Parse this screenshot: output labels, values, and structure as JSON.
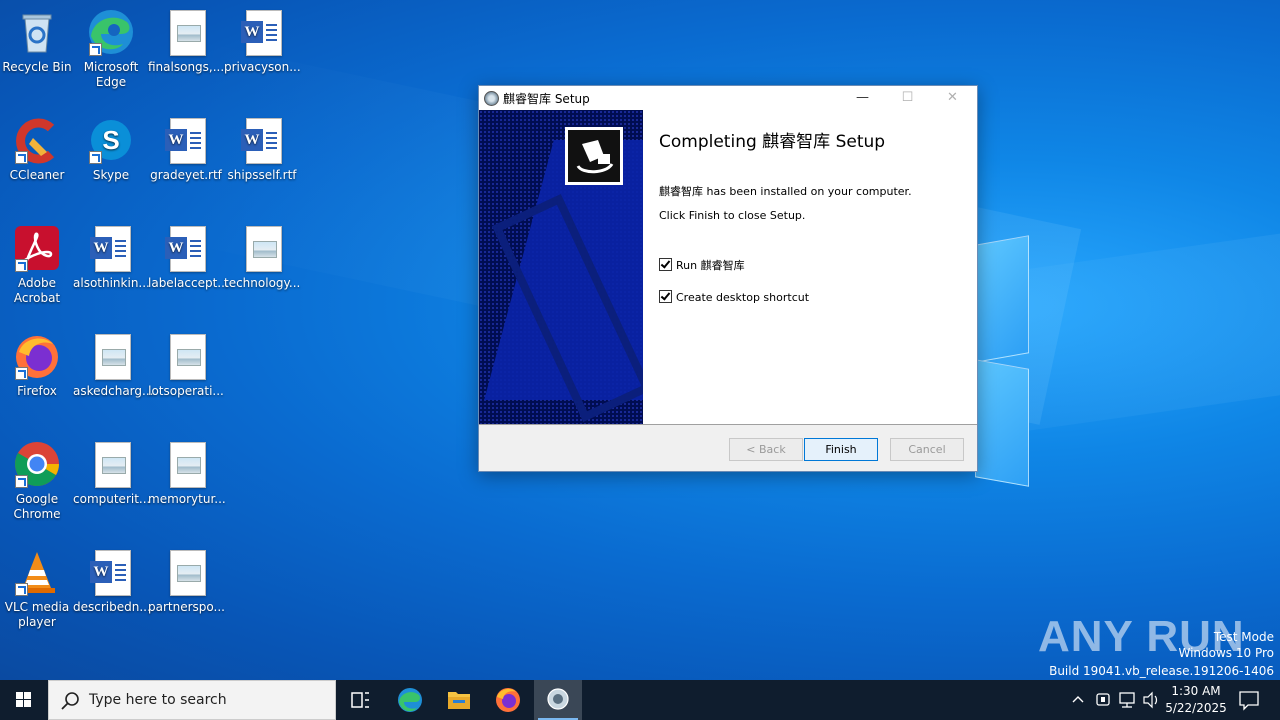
{
  "desktop": {
    "icons": [
      {
        "label": "Recycle Bin",
        "icon": "recycle-bin-icon"
      },
      {
        "label": "Microsoft Edge",
        "icon": "edge-icon"
      },
      {
        "label": "finalsongs,...",
        "icon": "image-file-icon"
      },
      {
        "label": "privacyson...",
        "icon": "word-file-icon"
      },
      {
        "label": "CCleaner",
        "icon": "ccleaner-icon"
      },
      {
        "label": "Skype",
        "icon": "skype-icon"
      },
      {
        "label": "gradeyet.rtf",
        "icon": "word-file-icon"
      },
      {
        "label": "shipsself.rtf",
        "icon": "word-file-icon"
      },
      {
        "label": "Adobe Acrobat",
        "icon": "acrobat-icon"
      },
      {
        "label": "alsothinkin...",
        "icon": "word-file-icon"
      },
      {
        "label": "labelaccept...",
        "icon": "word-file-icon"
      },
      {
        "label": "technology...",
        "icon": "image-file-icon"
      },
      {
        "label": "Firefox",
        "icon": "firefox-icon"
      },
      {
        "label": "askedcharg...",
        "icon": "image-file-icon"
      },
      {
        "label": "lotsoperati...",
        "icon": "image-file-icon"
      },
      {
        "label": "Google Chrome",
        "icon": "chrome-icon"
      },
      {
        "label": "computerit...",
        "icon": "image-file-icon"
      },
      {
        "label": "memorytur...",
        "icon": "image-file-icon"
      },
      {
        "label": "VLC media player",
        "icon": "vlc-icon"
      },
      {
        "label": "describedn...",
        "icon": "word-file-icon"
      },
      {
        "label": "partnerspo...",
        "icon": "image-file-icon"
      }
    ]
  },
  "setup_window": {
    "title": "麒睿智库 Setup",
    "minimize": "—",
    "maximize": "☐",
    "close": "✕",
    "heading": "Completing 麒睿智库 Setup",
    "message_installed": "麒睿智库 has been installed on your computer.",
    "message_finish": "Click Finish to close Setup.",
    "checkbox_run": "Run 麒睿智库",
    "checkbox_run_checked": true,
    "checkbox_shortcut": "Create desktop shortcut",
    "checkbox_shortcut_checked": true,
    "back_label": "< Back",
    "finish_label": "Finish",
    "cancel_label": "Cancel"
  },
  "watermark": {
    "brand": "ANY RUN",
    "mode": "Test Mode",
    "os": "Windows 10 Pro",
    "build": "Build 19041.vb_release.191206-1406"
  },
  "taskbar": {
    "search_placeholder": "Type here to search",
    "time": "1:30 AM",
    "date": "5/22/2025"
  }
}
